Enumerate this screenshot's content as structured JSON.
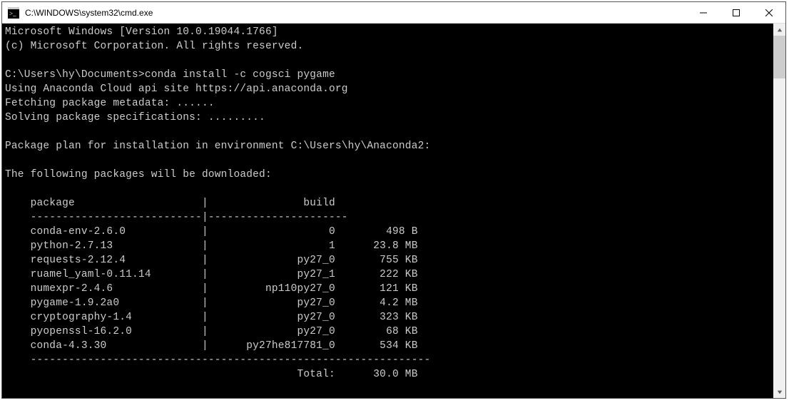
{
  "window": {
    "title": "C:\\WINDOWS\\system32\\cmd.exe"
  },
  "console": {
    "header1": "Microsoft Windows [Version 10.0.19044.1766]",
    "header2": "(c) Microsoft Corporation. All rights reserved.",
    "prompt": "C:\\Users\\hy\\Documents>",
    "command": "conda install -c cogsci pygame",
    "cloud": "Using Anaconda Cloud api site https://api.anaconda.org",
    "fetching": "Fetching package metadata: ......",
    "solving": "Solving package specifications: .........",
    "plan": "Package plan for installation in environment C:\\Users\\hy\\Anaconda2:",
    "downl": "The following packages will be downloaded:",
    "table": {
      "hdr_package": "package",
      "hdr_build": "build",
      "rows": [
        {
          "pkg": "conda-env-2.6.0",
          "build": "0",
          "size": "498 B"
        },
        {
          "pkg": "python-2.7.13",
          "build": "1",
          "size": "23.8 MB"
        },
        {
          "pkg": "requests-2.12.4",
          "build": "py27_0",
          "size": "755 KB"
        },
        {
          "pkg": "ruamel_yaml-0.11.14",
          "build": "py27_1",
          "size": "222 KB"
        },
        {
          "pkg": "numexpr-2.4.6",
          "build": "np110py27_0",
          "size": "121 KB"
        },
        {
          "pkg": "pygame-1.9.2a0",
          "build": "py27_0",
          "size": "4.2 MB"
        },
        {
          "pkg": "cryptography-1.4",
          "build": "py27_0",
          "size": "323 KB"
        },
        {
          "pkg": "pyopenssl-16.2.0",
          "build": "py27_0",
          "size": "68 KB"
        },
        {
          "pkg": "conda-4.3.30",
          "build": "py27he817781_0",
          "size": "534 KB"
        }
      ],
      "total_label": "Total:",
      "total_value": "30.0 MB"
    }
  }
}
